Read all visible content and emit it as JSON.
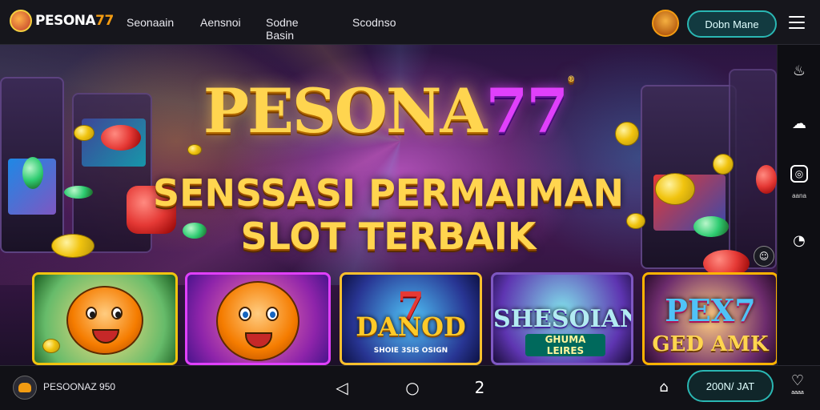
{
  "header": {
    "logo_text_main": "PESONA",
    "logo_text_num": "77",
    "nav": [
      "Seonaain",
      "Aensnoi",
      "Sodne Basin",
      "Scodnso"
    ],
    "action_button": "Dobn Mane",
    "avatar_icon": "user-avatar-icon",
    "menu_icon": "hamburger-menu-icon"
  },
  "hero": {
    "title_main": "PESONA",
    "title_num": "77",
    "trademark": "®",
    "subtitle_line1": "SENSSASI PERMAIMAN",
    "subtitle_line2": "SLOT TERBAIK"
  },
  "games": [
    {
      "name": "",
      "icon": "tiger-mascot-icon"
    },
    {
      "name": "",
      "icon": "tiger-mascot-icon"
    },
    {
      "big": "7",
      "name": "DANOD",
      "small": "SHOIE 3SIS OSIGN"
    },
    {
      "name": "SHESOIAN",
      "small": "GHUMA LEIRES"
    },
    {
      "name": "PEX7",
      "sub": "GED AMK"
    }
  ],
  "sidebar": {
    "items": [
      {
        "icon": "flame-icon",
        "label": ""
      },
      {
        "icon": "cloud-icon",
        "label": ""
      },
      {
        "icon": "chat-icon",
        "label": "aana"
      },
      {
        "icon": "apple-icon",
        "label": ""
      }
    ],
    "float_icon": "smile-icon"
  },
  "footer": {
    "user_name": "PESOONAZ 950",
    "nav": [
      {
        "icon": "back-triangle-icon",
        "glyph": "◁"
      },
      {
        "icon": "chat-bubble-icon",
        "glyph": "○"
      },
      {
        "icon": "number-icon",
        "glyph": "2"
      }
    ],
    "home_icon": "home-icon",
    "button": "200N/ JAT",
    "right_icon": "heart-icon",
    "right_label": "aaaa"
  }
}
